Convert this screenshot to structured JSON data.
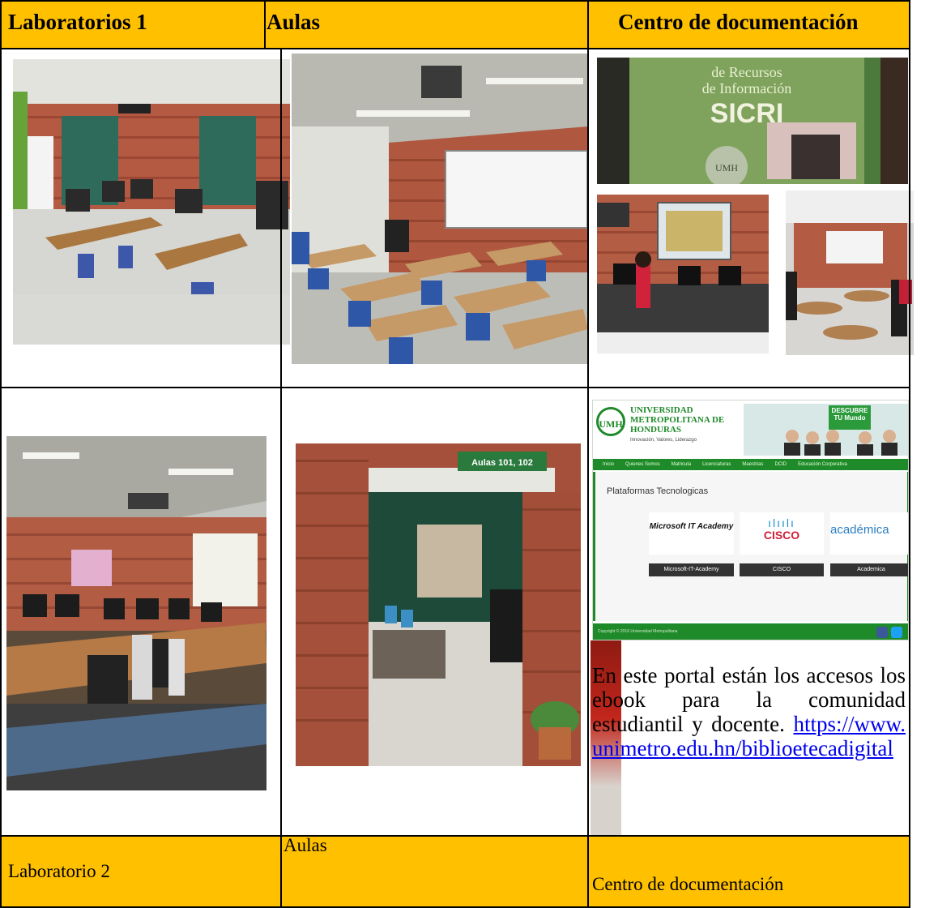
{
  "header": {
    "col1": "Laboratorios 1",
    "col2": "Aulas",
    "col3": "Centro de documentación"
  },
  "footer": {
    "col1": "Laboratorio 2",
    "col2": "Aulas",
    "col3": "Centro de documentación"
  },
  "photos": {
    "lab1": "computer-lab-photo",
    "aulas1": "classroom-photo",
    "sicri": "sicri-banner-photo",
    "doc_room": "documentation-center-computers-photo",
    "doc_reading": "reading-room-photo",
    "lab2": "computer-lab-2-photo",
    "aulas2": "hallway-photo"
  },
  "hallway_sign": "Aulas 101, 102",
  "sicri_sign": {
    "top": "de Recursos",
    "middle": "de Información",
    "big": "SICRI",
    "seal": "UMH"
  },
  "portal": {
    "logo": "UMH",
    "university_name": "UNIVERSIDAD METROPOLITANA DE HONDURAS",
    "tagline": "Innovación, Valores, Liderazgo",
    "banner_badge": "DESCUBRE TU Mundo",
    "nav": [
      "Inicio",
      "Quienes Somos",
      "Matricula",
      "Licenciaturas",
      "Maestrias",
      "DCID",
      "Educación Corporativa"
    ],
    "section_title": "Plataformas Tecnologicas",
    "platforms": [
      {
        "logo": "Microsoft IT Academy",
        "button": "Microsoft-IT-Academy"
      },
      {
        "logo": "CISCO",
        "button": "CISCO"
      },
      {
        "logo": "académica",
        "button": "Academica"
      }
    ],
    "footer_text": "Copyright © 2016 Universidad Metropolitana"
  },
  "description": {
    "text": "En este portal están los accesos los ebook para la comunidad estudiantil y docente.",
    "link": "https://www.unimetro.edu.hn/biblioetecadigital"
  },
  "colors": {
    "header_bg": "#ffc000",
    "link": "#0000ee",
    "portal_green": "#1f8a2a"
  }
}
